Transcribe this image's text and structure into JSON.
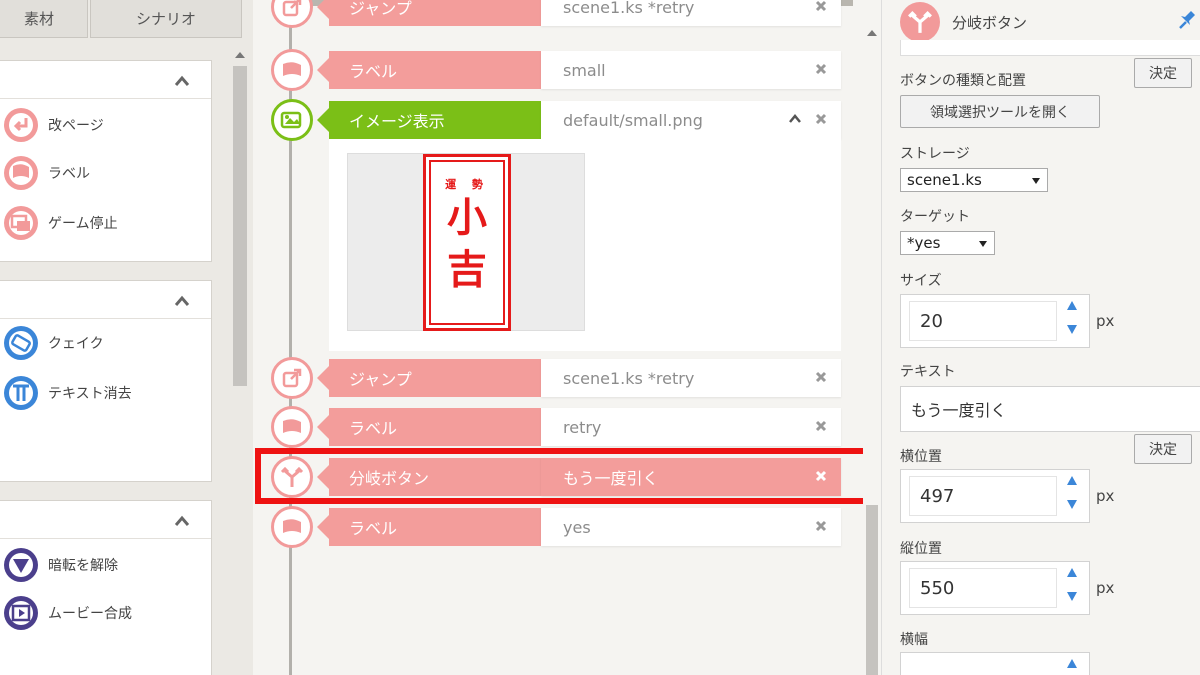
{
  "left_panel": {
    "tabs": [
      "素材",
      "シナリオ"
    ],
    "sections": [
      {
        "items": [
          {
            "icon": "page-break-icon",
            "label": "改ページ"
          },
          {
            "icon": "flag-icon",
            "label": "ラベル"
          },
          {
            "icon": "stop-icon",
            "label": "ゲーム停止"
          }
        ]
      },
      {
        "items": [
          {
            "icon": "shake-icon",
            "label": "クェイク"
          },
          {
            "icon": "text-clear-icon",
            "label": "テキスト消去"
          }
        ]
      },
      {
        "items": [
          {
            "icon": "unmask-icon",
            "label": "暗転を解除"
          },
          {
            "icon": "movie-icon",
            "label": "ムービー合成"
          }
        ]
      }
    ]
  },
  "timeline": {
    "rows": [
      {
        "type": "jump",
        "label": "ジャンプ",
        "value": "scene1.ks *retry",
        "color": "pink"
      },
      {
        "type": "label",
        "label": "ラベル",
        "value": "small",
        "color": "pink"
      },
      {
        "type": "image",
        "label": "イメージ表示",
        "value": "default/small.png",
        "color": "green",
        "expanded": true
      },
      {
        "type": "jump",
        "label": "ジャンプ",
        "value": "scene1.ks *retry",
        "color": "pink"
      },
      {
        "type": "label",
        "label": "ラベル",
        "value": "retry",
        "color": "pink"
      },
      {
        "type": "branch",
        "label": "分岐ボタン",
        "value": "もう一度引く",
        "color": "pink",
        "selected": true
      },
      {
        "type": "label",
        "label": "ラベル",
        "value": "yes",
        "color": "pink"
      }
    ],
    "image_preview": {
      "small_text": "運 勢",
      "big_char_1": "小",
      "big_char_2": "吉"
    }
  },
  "properties": {
    "title": "分岐ボタン",
    "decide_label": "決定",
    "button_type_label": "ボタンの種類と配置",
    "region_tool_button": "領域選択ツールを開く",
    "storage_label": "ストレージ",
    "storage_value": "scene1.ks",
    "target_label": "ターゲット",
    "target_value": "*yes",
    "size_label": "サイズ",
    "size_value": "20",
    "unit": "px",
    "text_label": "テキスト",
    "text_value": "もう一度引く",
    "x_label": "横位置",
    "x_value": "497",
    "y_label": "縦位置",
    "y_value": "550",
    "width_label": "横幅"
  },
  "colors": {
    "pink": "#f39d9b",
    "green": "#7bbf17",
    "selection": "#ee1212",
    "spinner": "#3b86d8"
  }
}
